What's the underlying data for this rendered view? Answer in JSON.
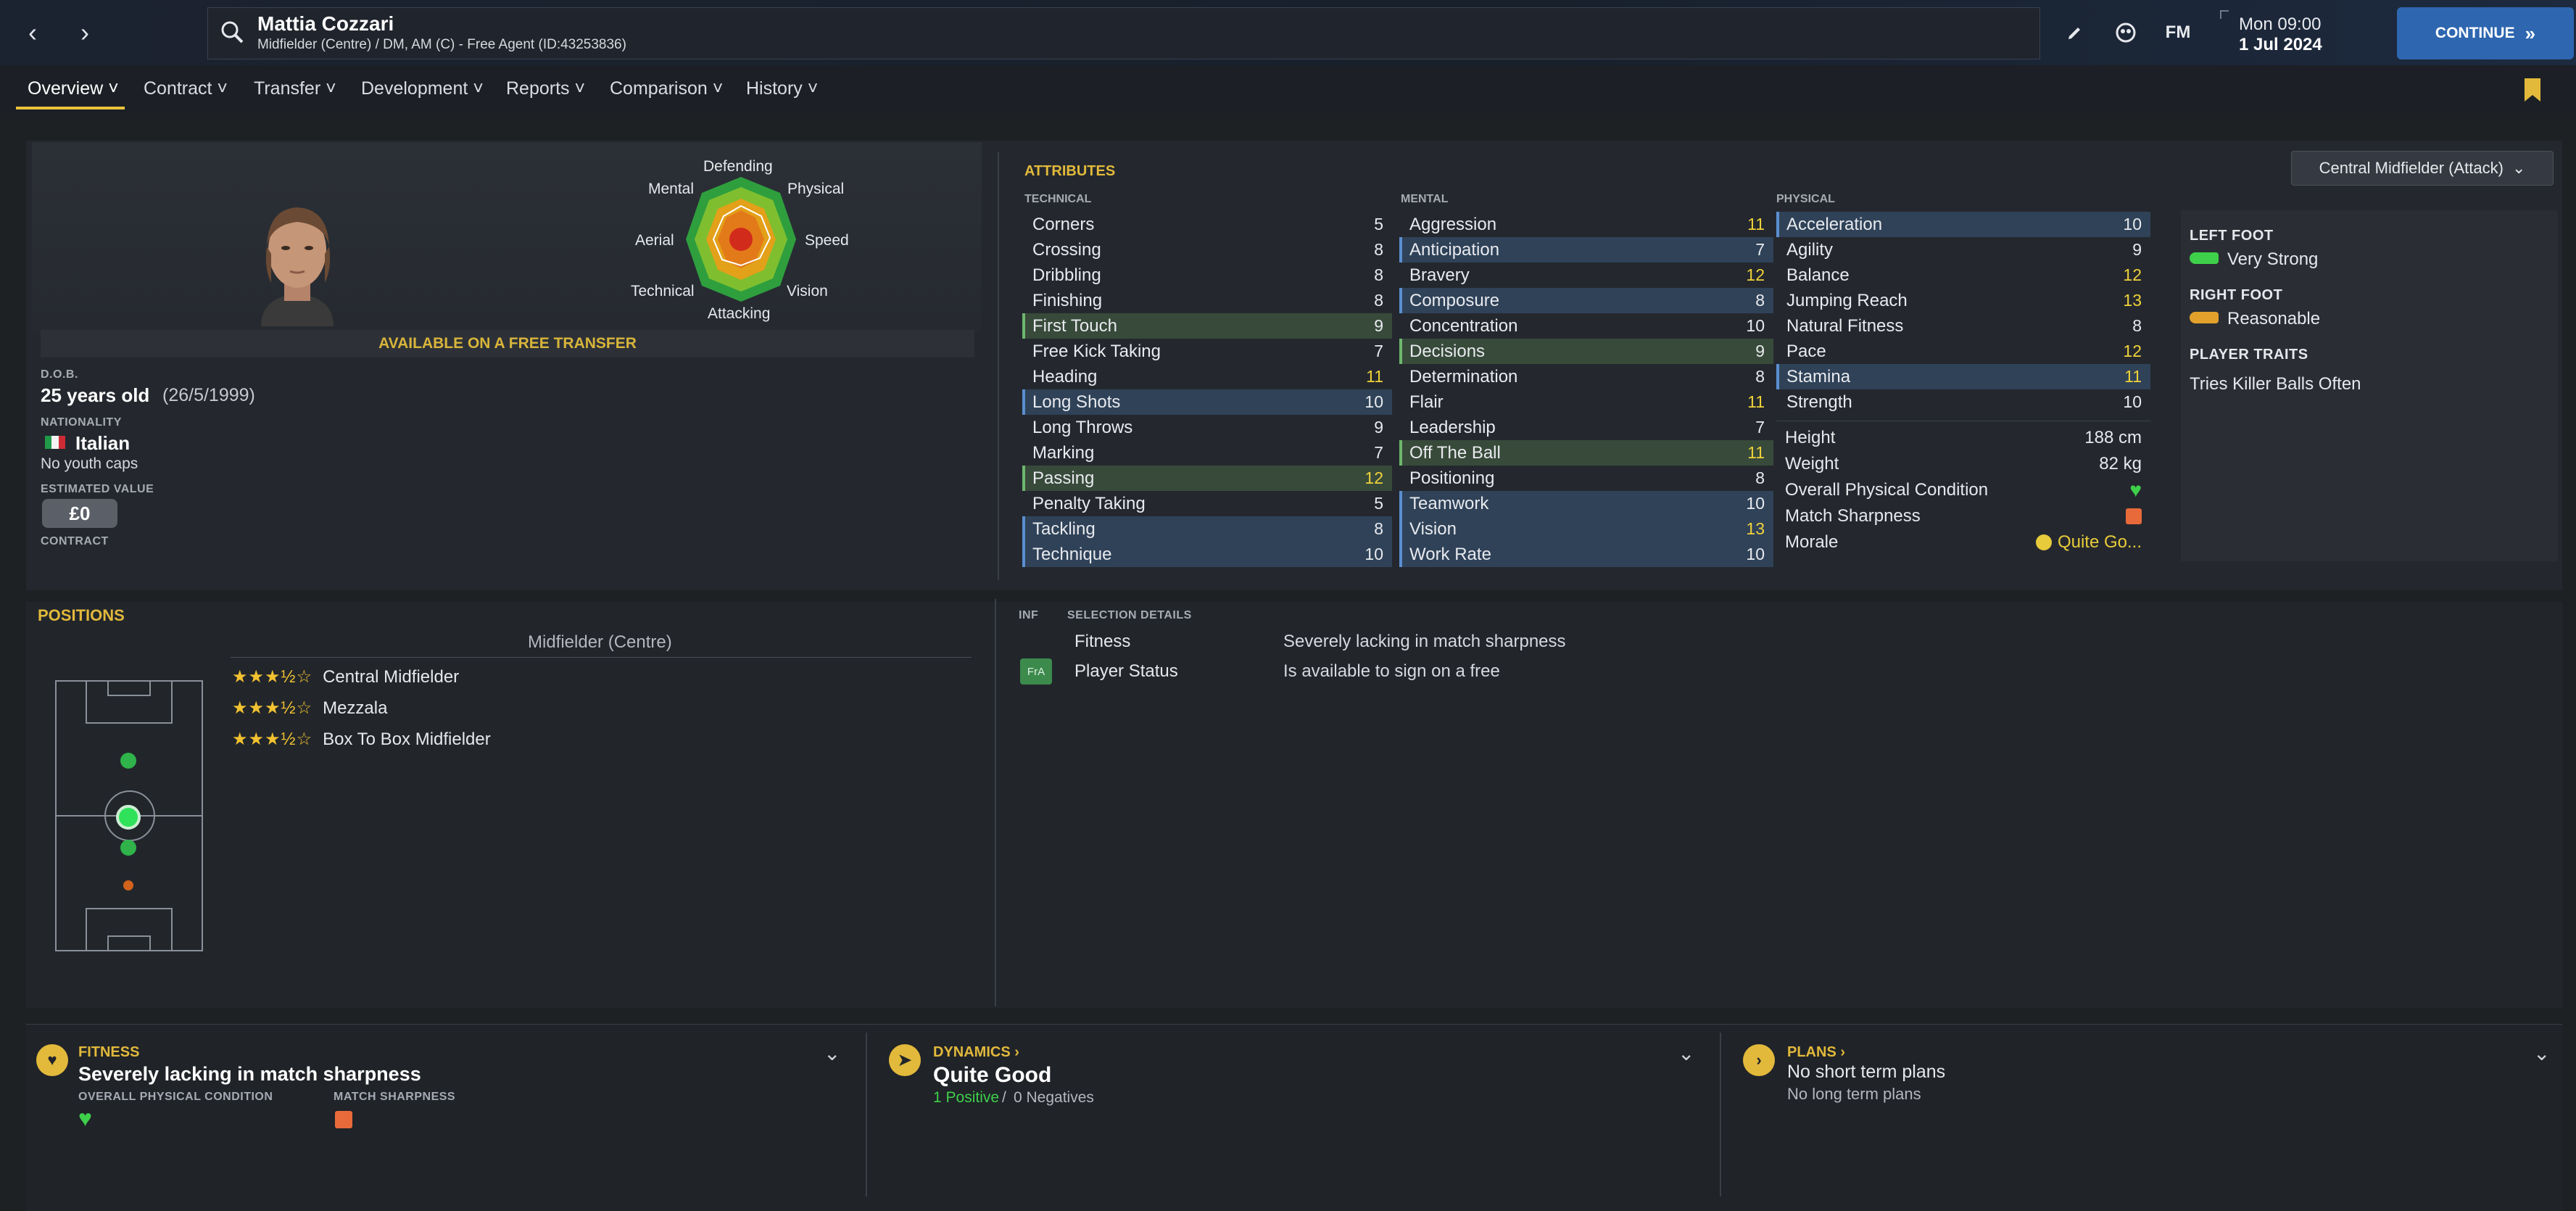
{
  "player": {
    "name": "Mattia Cozzari",
    "subtitle": "Midfielder (Centre) / DM, AM (C) - Free Agent (ID:43253836)"
  },
  "topbar": {
    "fm_label": "FM",
    "date_day": "Mon 09:00",
    "date_date": "1 Jul 2024",
    "continue_label": "CONTINUE",
    "icons": [
      "back-icon",
      "forward-icon",
      "search-icon",
      "edit-icon",
      "globe-icon",
      "fm-logo"
    ]
  },
  "tabs": [
    {
      "label": "Overview"
    },
    {
      "label": "Contract"
    },
    {
      "label": "Transfer"
    },
    {
      "label": "Development"
    },
    {
      "label": "Reports"
    },
    {
      "label": "Comparison"
    },
    {
      "label": "History"
    }
  ],
  "profile": {
    "radar_labels": {
      "defending": "Defending",
      "physical": "Physical",
      "speed": "Speed",
      "vision": "Vision",
      "attacking": "Attacking",
      "technical": "Technical",
      "aerial": "Aerial",
      "mental": "Mental"
    },
    "free_transfer": "AVAILABLE ON A FREE TRANSFER",
    "dob_label": "D.O.B.",
    "age": "25 years old",
    "dob": "(26/5/1999)",
    "nationality_label": "NATIONALITY",
    "nationality": "Italian",
    "youth_caps": "No youth caps",
    "value_label": "ESTIMATED VALUE",
    "value": "£0",
    "contract_label": "CONTRACT"
  },
  "attributes": {
    "title": "ATTRIBUTES",
    "role": "Central Midfielder (Attack)",
    "technical_label": "TECHNICAL",
    "mental_label": "MENTAL",
    "physical_label": "PHYSICAL",
    "technical": [
      {
        "name": "Corners",
        "value": "5",
        "hl": ""
      },
      {
        "name": "Crossing",
        "value": "8",
        "hl": ""
      },
      {
        "name": "Dribbling",
        "value": "8",
        "hl": ""
      },
      {
        "name": "Finishing",
        "value": "8",
        "hl": ""
      },
      {
        "name": "First Touch",
        "value": "9",
        "hl": "green"
      },
      {
        "name": "Free Kick Taking",
        "value": "7",
        "hl": ""
      },
      {
        "name": "Heading",
        "value": "11",
        "hl": ""
      },
      {
        "name": "Long Shots",
        "value": "10",
        "hl": "blue"
      },
      {
        "name": "Long Throws",
        "value": "9",
        "hl": ""
      },
      {
        "name": "Marking",
        "value": "7",
        "hl": ""
      },
      {
        "name": "Passing",
        "value": "12",
        "hl": "green"
      },
      {
        "name": "Penalty Taking",
        "value": "5",
        "hl": ""
      },
      {
        "name": "Tackling",
        "value": "8",
        "hl": "blue"
      },
      {
        "name": "Technique",
        "value": "10",
        "hl": "blue"
      }
    ],
    "mental": [
      {
        "name": "Aggression",
        "value": "11",
        "hl": ""
      },
      {
        "name": "Anticipation",
        "value": "7",
        "hl": "blue"
      },
      {
        "name": "Bravery",
        "value": "12",
        "hl": ""
      },
      {
        "name": "Composure",
        "value": "8",
        "hl": "blue"
      },
      {
        "name": "Concentration",
        "value": "10",
        "hl": ""
      },
      {
        "name": "Decisions",
        "value": "9",
        "hl": "green"
      },
      {
        "name": "Determination",
        "value": "8",
        "hl": ""
      },
      {
        "name": "Flair",
        "value": "11",
        "hl": ""
      },
      {
        "name": "Leadership",
        "value": "7",
        "hl": ""
      },
      {
        "name": "Off The Ball",
        "value": "11",
        "hl": "green"
      },
      {
        "name": "Positioning",
        "value": "8",
        "hl": ""
      },
      {
        "name": "Teamwork",
        "value": "10",
        "hl": "blue"
      },
      {
        "name": "Vision",
        "value": "13",
        "hl": "blue"
      },
      {
        "name": "Work Rate",
        "value": "10",
        "hl": "blue"
      }
    ],
    "physical": [
      {
        "name": "Acceleration",
        "value": "10",
        "hl": "blue"
      },
      {
        "name": "Agility",
        "value": "9",
        "hl": ""
      },
      {
        "name": "Balance",
        "value": "12",
        "hl": ""
      },
      {
        "name": "Jumping Reach",
        "value": "13",
        "hl": ""
      },
      {
        "name": "Natural Fitness",
        "value": "8",
        "hl": ""
      },
      {
        "name": "Pace",
        "value": "12",
        "hl": ""
      },
      {
        "name": "Stamina",
        "value": "11",
        "hl": "blue"
      },
      {
        "name": "Strength",
        "value": "10",
        "hl": ""
      }
    ],
    "info": {
      "height_label": "Height",
      "height": "188 cm",
      "weight_label": "Weight",
      "weight": "82 kg",
      "condition_label": "Overall Physical Condition",
      "sharpness_label": "Match Sharpness",
      "morale_label": "Morale",
      "morale": "Quite Go..."
    }
  },
  "side": {
    "left_foot_label": "LEFT FOOT",
    "left_foot": "Very Strong",
    "right_foot_label": "RIGHT FOOT",
    "right_foot": "Reasonable",
    "traits_label": "PLAYER TRAITS",
    "trait": "Tries Killer Balls Often"
  },
  "positions": {
    "title": "POSITIONS",
    "group": "Midfielder (Centre)",
    "items": [
      {
        "stars": "★★★½☆",
        "name": "Central Midfielder"
      },
      {
        "stars": "★★★½☆",
        "name": "Mezzala"
      },
      {
        "stars": "★★★½☆",
        "name": "Box To Box Midfielder"
      }
    ]
  },
  "selection": {
    "inf_label": "INF",
    "details_label": "SELECTION DETAILS",
    "rows": [
      {
        "badge": "",
        "label": "Fitness",
        "value": "Severely lacking in match sharpness"
      },
      {
        "badge": "FrA",
        "label": "Player Status",
        "value": "Is available to sign on a free"
      }
    ]
  },
  "cards": {
    "fitness": {
      "title": "FITNESS",
      "main": "Severely lacking in match sharpness",
      "sub1": "OVERALL PHYSICAL CONDITION",
      "sub2": "MATCH SHARPNESS"
    },
    "dynamics": {
      "title": "DYNAMICS",
      "main": "Quite Good",
      "positive": "1 Positive",
      "sep": "/",
      "negative": "0 Negatives"
    },
    "plans": {
      "title": "PLANS",
      "main": "No short term plans",
      "sub": "No long term plans"
    }
  },
  "colors": {
    "accent": "#e2b93b",
    "continue": "#2e66b0",
    "highlight_blue": "#2f4258",
    "highlight_green": "#384a3a",
    "stat_high": "#f0d23a"
  }
}
